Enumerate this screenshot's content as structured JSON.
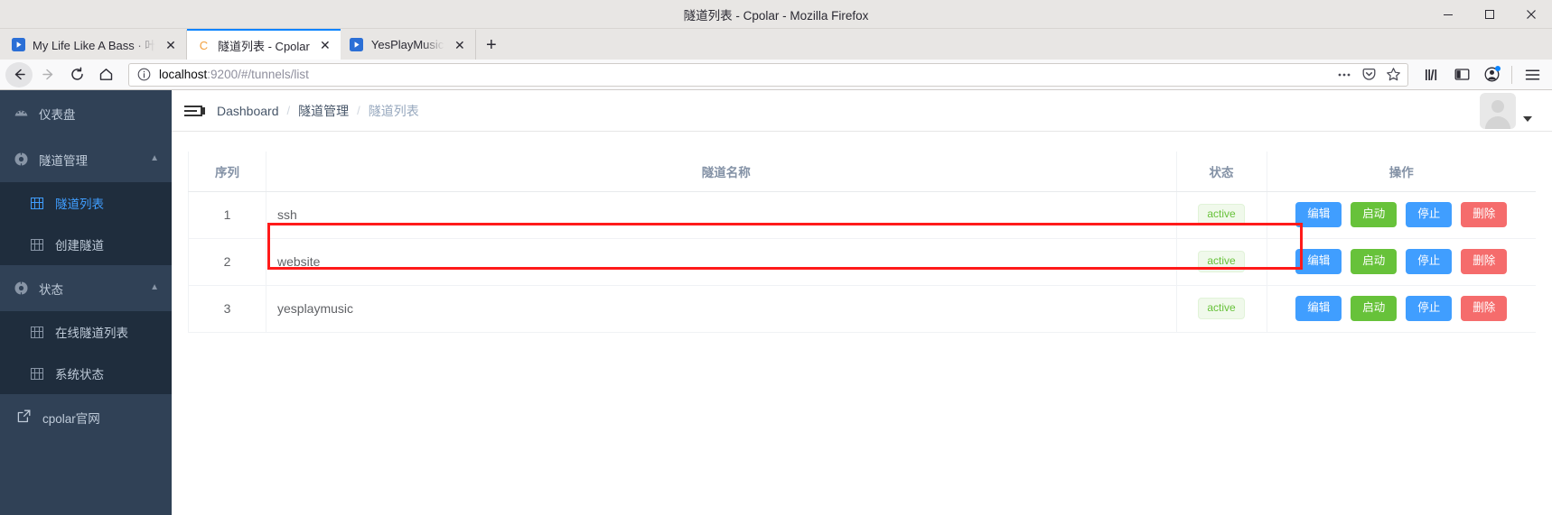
{
  "window": {
    "title": "隧道列表 - Cpolar - Mozilla Firefox",
    "minimize_label": "minimize-icon",
    "maximize_label": "maximize-icon",
    "close_label": "close-icon"
  },
  "tabs": [
    {
      "title": "My Life Like A Bass · 叶尔",
      "favicon": "play-icon",
      "active": false
    },
    {
      "title": "隧道列表 - Cpolar",
      "favicon": "cpolar-c-icon",
      "active": true
    },
    {
      "title": "YesPlayMusic",
      "favicon": "play-icon",
      "active": false
    }
  ],
  "new_tab_label": "+",
  "navigation": {
    "back": "back-arrow-icon",
    "forward": "forward-arrow-icon",
    "reload": "reload-icon",
    "home": "home-icon"
  },
  "urlbar": {
    "identity_icon": "info-circle-icon",
    "host": "localhost",
    "path": ":9200/#/tunnels/list",
    "full_url": "localhost:9200/#/tunnels/list",
    "ellipsis": "page-actions-icon",
    "pocket": "pocket-icon",
    "bookmark": "star-icon"
  },
  "toolbar_right": {
    "library": "library-icon",
    "sidebar": "sidebar-icon",
    "account": "account-icon",
    "menu": "hamburger-menu-icon"
  },
  "sidebar": {
    "bg_color": "#304156",
    "submenu_bg_color": "#1f2d3d",
    "active_color": "#409eff",
    "items": [
      {
        "label": "仪表盘",
        "icon": "dashboard-gauge-icon",
        "type": "item"
      },
      {
        "label": "隧道管理",
        "icon": "tunnel-target-icon",
        "type": "group",
        "arrow": "chevron-up-icon",
        "expanded": true
      },
      {
        "label": "隧道列表",
        "icon": "grid-icon",
        "type": "sub",
        "active": true
      },
      {
        "label": "创建隧道",
        "icon": "grid-icon",
        "type": "sub",
        "active": false
      },
      {
        "label": "状态",
        "icon": "status-target-icon",
        "type": "group",
        "arrow": "chevron-up-icon",
        "expanded": true
      },
      {
        "label": "在线隧道列表",
        "icon": "grid-icon",
        "type": "sub",
        "active": false
      },
      {
        "label": "系统状态",
        "icon": "grid-icon",
        "type": "sub",
        "active": false
      }
    ],
    "external": {
      "label": "cpolar官网",
      "icon": "external-link-icon"
    }
  },
  "topbar": {
    "collapse_icon": "collapse-menu-icon",
    "breadcrumb": [
      {
        "label": "Dashboard",
        "current": false
      },
      {
        "label": "隧道管理",
        "current": false
      },
      {
        "label": "隧道列表",
        "current": true
      }
    ],
    "separator": "/",
    "avatar": "user-avatar-placeholder",
    "avatar_caret": "caret-down-icon"
  },
  "table": {
    "columns": [
      "序列",
      "隧道名称",
      "状态",
      "操作"
    ],
    "rows": [
      {
        "seq": "1",
        "name": "ssh",
        "status": "active",
        "actions": [
          "编辑",
          "启动",
          "停止",
          "删除"
        ]
      },
      {
        "seq": "2",
        "name": "website",
        "status": "active",
        "actions": [
          "编辑",
          "启动",
          "停止",
          "删除"
        ]
      },
      {
        "seq": "3",
        "name": "yesplaymusic",
        "status": "active",
        "actions": [
          "编辑",
          "启动",
          "停止",
          "删除"
        ]
      }
    ]
  },
  "annotation": {
    "color": "#ff1a1a",
    "target_row": "3"
  },
  "colors": {
    "primary_blue": "#409eff",
    "success_green": "#67c23a",
    "danger_red": "#f56c6c",
    "tag_green_text": "#67c23a",
    "tag_green_bg": "#f0f9eb"
  }
}
